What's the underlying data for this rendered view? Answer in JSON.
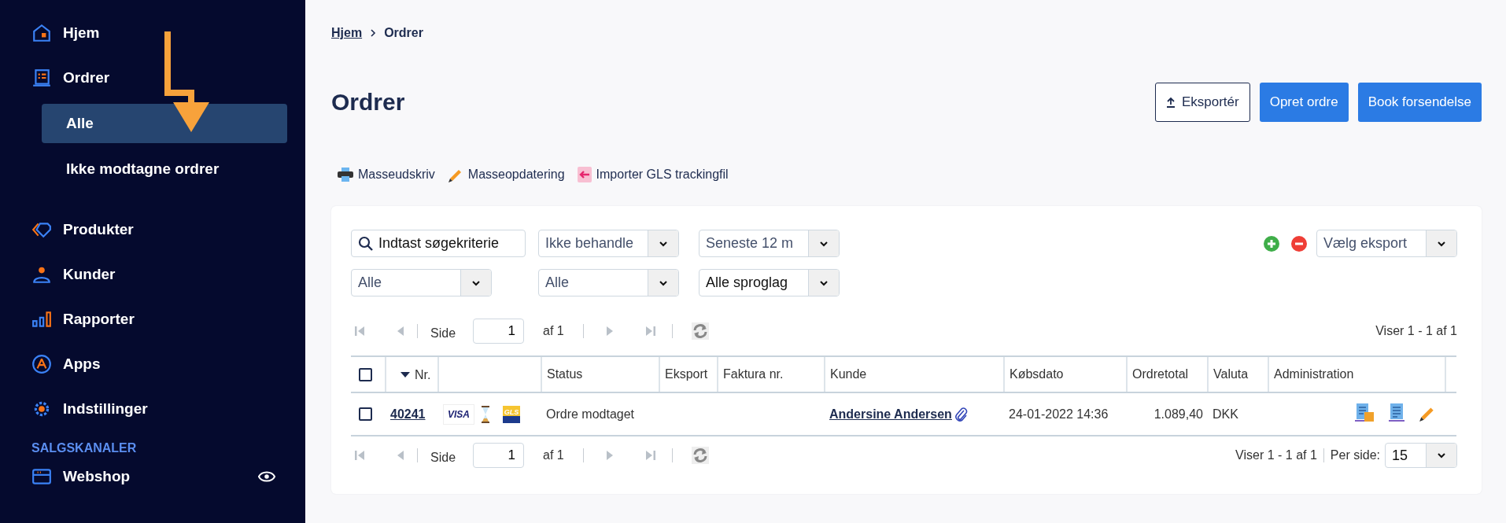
{
  "sidebar": {
    "items": [
      {
        "label": "Hjem",
        "selected": false
      },
      {
        "label": "Ordrer",
        "selected": false,
        "children": [
          {
            "label": "Alle",
            "selected": true
          },
          {
            "label": "Ikke modtagne ordrer",
            "selected": false
          }
        ]
      },
      {
        "label": "Produkter",
        "selected": false
      },
      {
        "label": "Kunder",
        "selected": false
      },
      {
        "label": "Rapporter",
        "selected": false
      },
      {
        "label": "Apps",
        "selected": false
      },
      {
        "label": "Indstillinger",
        "selected": false
      }
    ],
    "section": "SALGSKANALER",
    "channels": [
      {
        "label": "Webshop",
        "visible": true
      }
    ]
  },
  "breadcrumb": [
    {
      "label": "Hjem",
      "link": true
    },
    {
      "label": "Ordrer",
      "link": false
    }
  ],
  "title": "Ordrer",
  "buttons": [
    {
      "label": "Eksportér",
      "kind": "outline"
    },
    {
      "label": "Opret ordre",
      "kind": "primary"
    },
    {
      "label": "Book forsendelse",
      "kind": "primary"
    }
  ],
  "toolbar": [
    "Masseudskriv",
    "Masseopdatering",
    "Importer GLS trackingfil"
  ],
  "filters": {
    "search": {
      "placeholder": "Indtast søgekriterie"
    },
    "selects": [
      [
        "Ikke behandle",
        "Seneste 12 m"
      ],
      [
        "Alle",
        "Alle",
        "Alle sproglag"
      ]
    ],
    "export_select": "Vælg eksport"
  },
  "pager_top": {
    "side": "Side",
    "page": "1",
    "of": "af 1",
    "info": "Viser 1 - 1 af 1"
  },
  "table": {
    "columns": [
      {
        "kind": "check",
        "checked": false
      },
      {
        "kind": "text",
        "label": "Nr.",
        "sorted": true
      },
      {
        "kind": "blank"
      },
      {
        "kind": "text",
        "label": "Status",
        "sorted": false
      },
      {
        "kind": "text",
        "label": "Eksport",
        "sorted": false
      },
      {
        "kind": "text",
        "label": "Faktura nr.",
        "sorted": false
      },
      {
        "kind": "text",
        "label": "Kunde",
        "sorted": false
      },
      {
        "kind": "text",
        "label": "Købsdato",
        "sorted": false
      },
      {
        "kind": "text",
        "label": "Ordretotal",
        "sorted": false
      },
      {
        "kind": "text",
        "label": "Valuta",
        "sorted": false
      },
      {
        "kind": "text",
        "label": "Administration",
        "sorted": false
      },
      {
        "kind": "blank"
      }
    ],
    "rows": [
      {
        "checked": false,
        "nr": "40241",
        "payment": "VISA",
        "carrier": "GLS",
        "status": "Ordre modtaget",
        "kunde": "Andersine Andersen",
        "attachment": true,
        "dato": "24-01-2022 14:36",
        "total": "1.089,40",
        "valuta": "DKK"
      }
    ]
  },
  "pager_bottom": {
    "side": "Side",
    "page": "1",
    "of": "af 1",
    "info": "Viser 1 - 1 af 1",
    "per_side_label": "Per side:",
    "per_side": "15"
  }
}
